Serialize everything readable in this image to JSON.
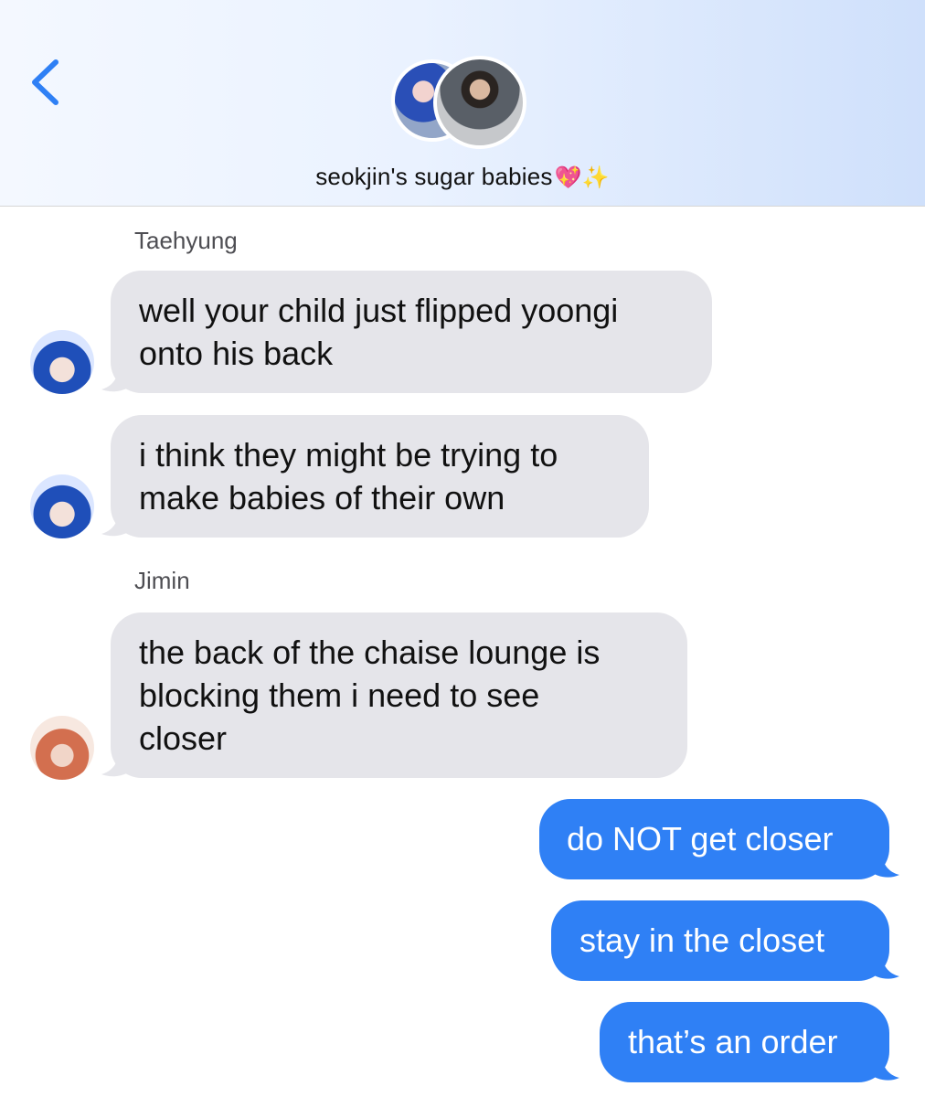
{
  "header": {
    "back_icon": "chevron-left-icon",
    "title": "seokjin's sugar babies",
    "title_emoji": "💖✨",
    "accent_color": "#2f80f5"
  },
  "messages": [
    {
      "sender": "Taehyung",
      "direction": "incoming",
      "lines": [
        "well your child just flipped yoongi",
        "onto his back"
      ]
    },
    {
      "sender": "Taehyung",
      "direction": "incoming",
      "lines": [
        "i think they might be trying to",
        "make babies of their own"
      ]
    },
    {
      "sender": "Jimin",
      "direction": "incoming",
      "lines": [
        "the back of the chaise lounge is",
        "blocking them i need to see",
        "closer"
      ]
    },
    {
      "sender": "me",
      "direction": "outgoing",
      "lines": [
        "do NOT get closer"
      ]
    },
    {
      "sender": "me",
      "direction": "outgoing",
      "lines": [
        "stay in the closet"
      ]
    },
    {
      "sender": "me",
      "direction": "outgoing",
      "lines": [
        "that’s an order"
      ]
    }
  ],
  "colors": {
    "incoming_bubble": "#e5e5ea",
    "outgoing_bubble": "#2f80f5"
  }
}
